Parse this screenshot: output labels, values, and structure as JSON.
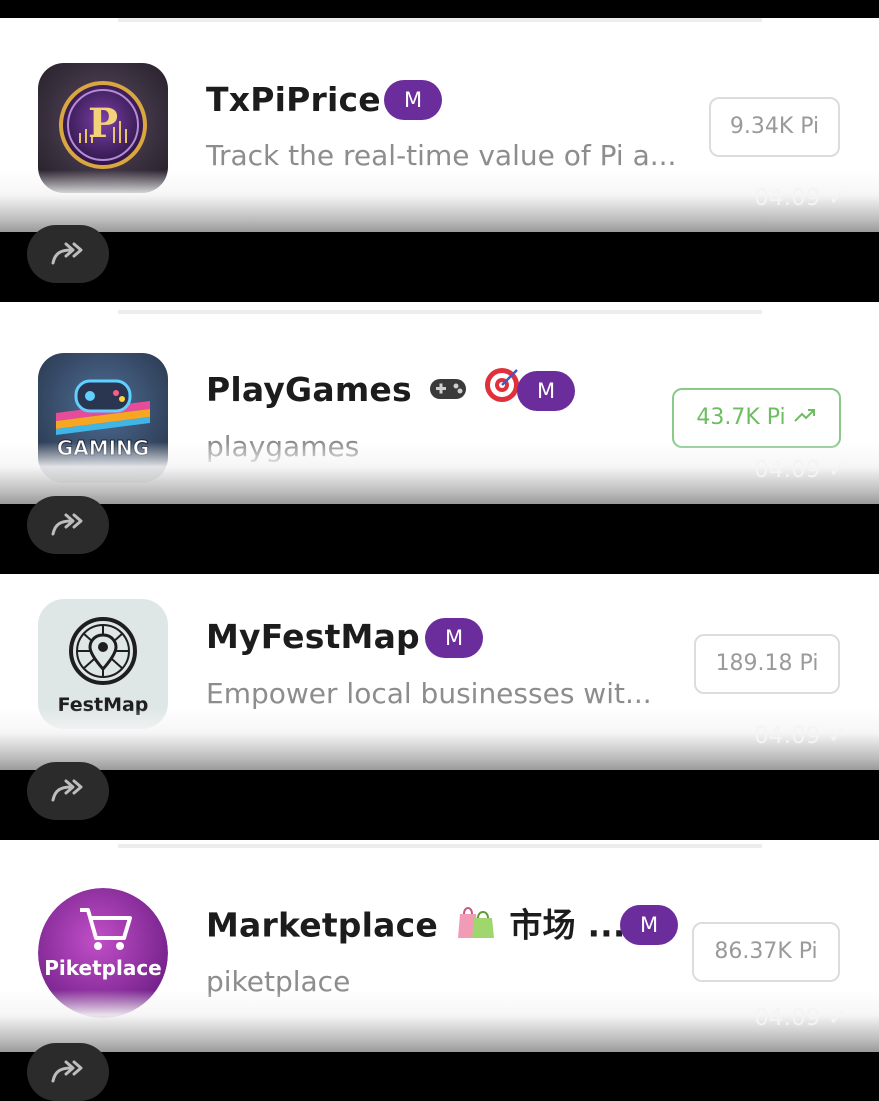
{
  "apps": [
    {
      "title": "TxPiPrice",
      "badge": "M",
      "description": "Track the real-time value of Pi a...",
      "price": "9.34K Pi",
      "trend": "",
      "time": "04:09",
      "icon": "txpiprice-logo-icon"
    },
    {
      "title": "PlayGames",
      "badge": "M",
      "description": "playgames",
      "price": "43.7K Pi",
      "trend": "up",
      "time": "04:09",
      "icon": "gaming-logo-icon",
      "icon_text": "GAMING",
      "title_emojis": [
        "game-controller-emoji",
        "target-emoji"
      ]
    },
    {
      "title": "MyFestMap",
      "badge": "M",
      "description": "Empower local businesses wit...",
      "price": "189.18 Pi",
      "trend": "",
      "time": "04:09",
      "icon": "festmap-logo-icon",
      "icon_text": "FestMap"
    },
    {
      "title": "Marketplace",
      "title_suffix": "市场 ...",
      "badge": "M",
      "description": "piketplace",
      "price": "86.37K Pi",
      "trend": "",
      "time": "04:09",
      "icon": "piketplace-logo-icon",
      "icon_text": "Piketplace",
      "title_emojis": [
        "shopping-bags-emoji"
      ]
    }
  ],
  "colors": {
    "badge": "#6b2d9c",
    "price_up": "#6fbd63",
    "background": "#000000",
    "card": "#ffffff"
  }
}
